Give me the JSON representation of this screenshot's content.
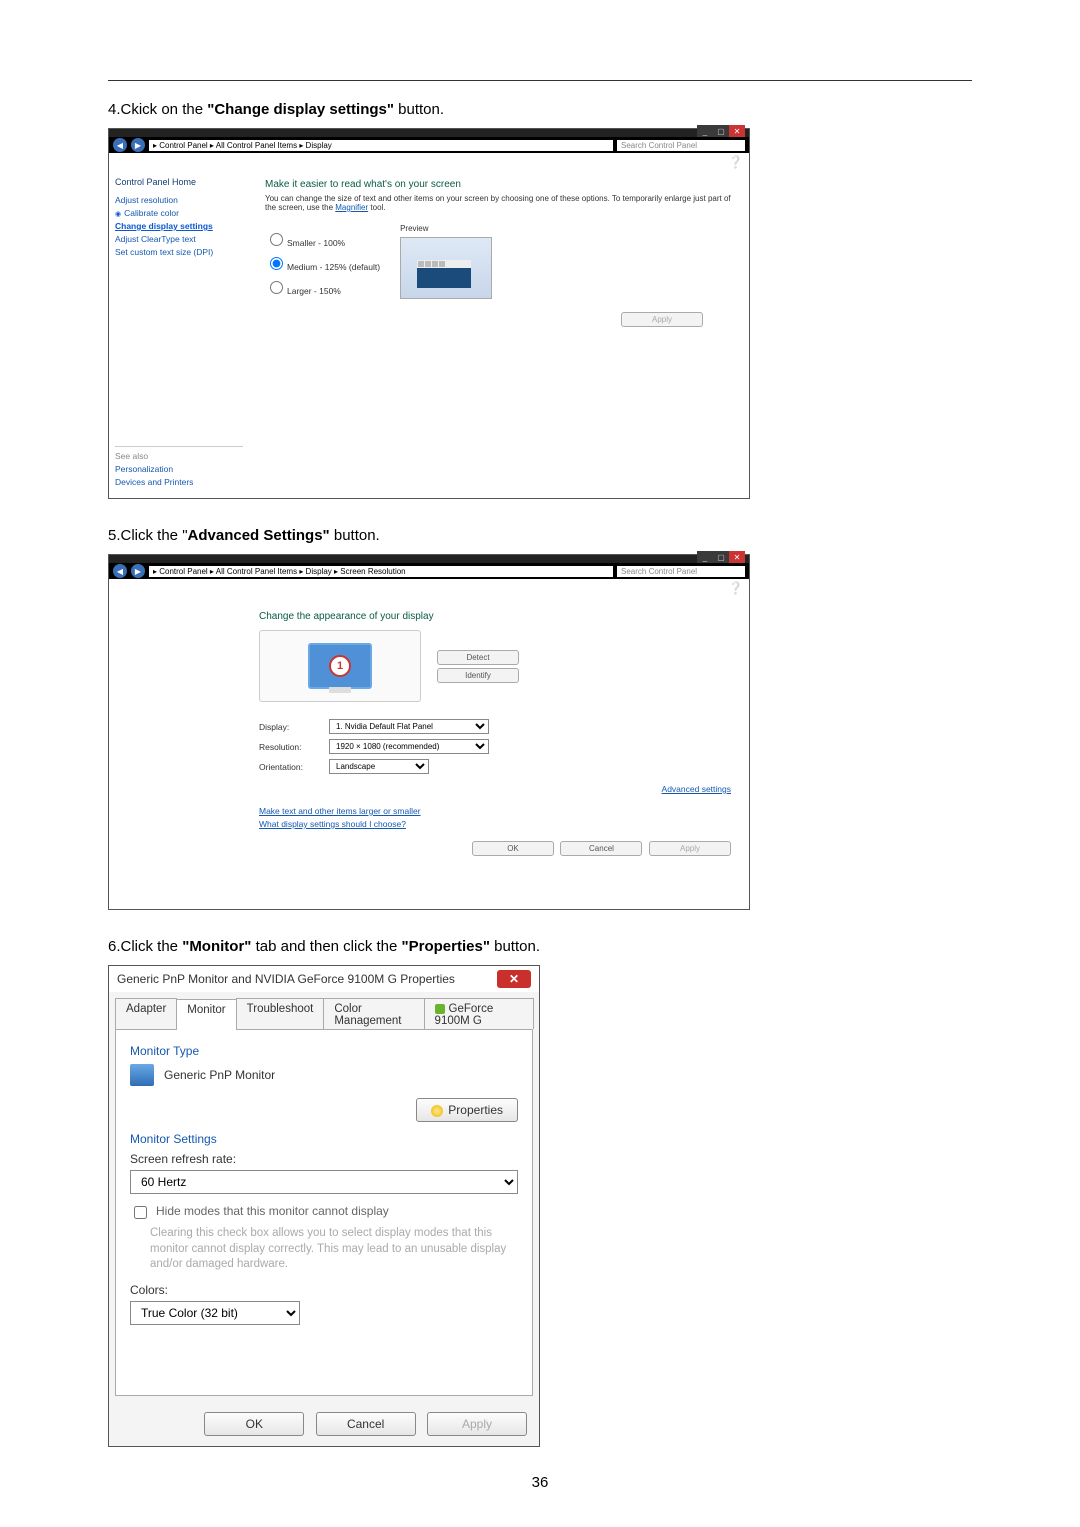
{
  "page_number": "36",
  "step4": {
    "prefix": "4.Ckick on the ",
    "bold": "\"Change display settings\"",
    "suffix": " button."
  },
  "step5": {
    "prefix": "5.Click the \"",
    "bold": "Advanced Settings\"",
    "suffix": " button."
  },
  "step6": {
    "prefix": "6.Click the ",
    "bold1": "\"Monitor\"",
    "mid": " tab and then click the ",
    "bold2": "\"Properties\"",
    "suffix": " button."
  },
  "shot1": {
    "breadcrumb": "▸ Control Panel ▸ All Control Panel Items ▸ Display",
    "search_placeholder": "Search Control Panel",
    "side": {
      "header": "Control Panel Home",
      "links": [
        {
          "label": "Adjust resolution",
          "active": false,
          "icon": false
        },
        {
          "label": "Calibrate color",
          "active": false,
          "icon": true
        },
        {
          "label": "Change display settings",
          "active": true,
          "icon": false
        },
        {
          "label": "Adjust ClearType text",
          "active": false,
          "icon": false
        },
        {
          "label": "Set custom text size (DPI)",
          "active": false,
          "icon": false
        }
      ],
      "see_also": "See also",
      "see_links": [
        "Personalization",
        "Devices and Printers"
      ]
    },
    "main": {
      "heading": "Make it easier to read what's on your screen",
      "desc_a": "You can change the size of text and other items on your screen by choosing one of these options. To temporarily enlarge just part of the screen, use the ",
      "magnifier": "Magnifier",
      "desc_b": " tool.",
      "opts": [
        "Smaller - 100%",
        "Medium - 125% (default)",
        "Larger - 150%"
      ],
      "preview": "Preview",
      "apply": "Apply"
    }
  },
  "shot2": {
    "breadcrumb": "▸ Control Panel ▸ All Control Panel Items ▸ Display ▸ Screen Resolution",
    "search_placeholder": "Search Control Panel",
    "heading": "Change the appearance of your display",
    "detect": "Detect",
    "identify": "Identify",
    "mon_label": "1",
    "fields": {
      "display_lbl": "Display:",
      "display_val": "1. Nvidia Default Flat Panel",
      "res_lbl": "Resolution:",
      "res_val": "1920 × 1080 (recommended)",
      "orient_lbl": "Orientation:",
      "orient_val": "Landscape"
    },
    "advanced": "Advanced settings",
    "links": [
      "Make text and other items larger or smaller",
      "What display settings should I choose?"
    ],
    "ok": "OK",
    "cancel": "Cancel",
    "apply": "Apply"
  },
  "shot3": {
    "title": "Generic PnP Monitor and NVIDIA GeForce 9100M G   Properties",
    "tabs": [
      "Adapter",
      "Monitor",
      "Troubleshoot",
      "Color Management",
      "GeForce 9100M G"
    ],
    "monitor_type_lbl": "Monitor Type",
    "monitor_type_val": "Generic PnP Monitor",
    "properties_btn": "Properties",
    "monitor_settings_lbl": "Monitor Settings",
    "refresh_lbl": "Screen refresh rate:",
    "refresh_val": "60 Hertz",
    "hide_modes": "Hide modes that this monitor cannot display",
    "hide_note": "Clearing this check box allows you to select display modes that this monitor cannot display correctly. This may lead to an unusable display and/or damaged hardware.",
    "colors_lbl": "Colors:",
    "colors_val": "True Color (32 bit)",
    "ok": "OK",
    "cancel": "Cancel",
    "apply": "Apply"
  }
}
